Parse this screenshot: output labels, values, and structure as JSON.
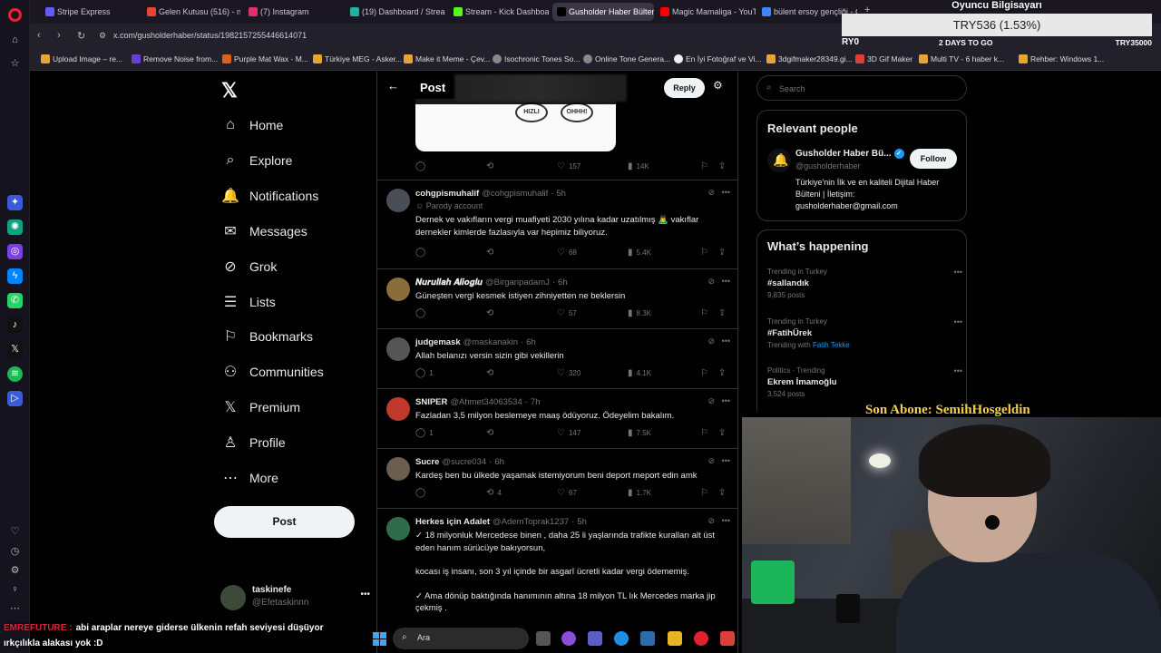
{
  "browser": {
    "tabs": [
      {
        "label": "Stripe Express",
        "color": "#635bff"
      },
      {
        "label": "Gelen Kutusu (516) - nose",
        "color": "#ea4335"
      },
      {
        "label": "(7) Instagram",
        "color": "#e1306c"
      },
      {
        "label": "(19) Dashboard / Streamla",
        "color": "#1bb5a0"
      },
      {
        "label": "Stream - Kick Dashboard",
        "color": "#53fc18"
      },
      {
        "label": "Gusholder Haber Bülteni",
        "color": "#000000"
      },
      {
        "label": "Magic Mamaliga - YouTub",
        "color": "#ff0000"
      },
      {
        "label": "bülent ersoy gençliği - Go",
        "color": "#4285f4"
      }
    ],
    "url": "x.com/gusholderhaber/status/1982157255446614071",
    "bookmarks": [
      "Upload Image – re...",
      "Remove Noise from...",
      "Purple Mat Wax - M...",
      "Türkiye MEG - Asker...",
      "Make it Meme - Çev...",
      "Isochronic Tones So...",
      "Online Tone Genera...",
      "En İyi Fotoğraf ve Vi...",
      "3dgifmaker28349.gi...",
      "3D Gif Maker",
      "Multi TV - 6 haber k...",
      "Rehber: Windows 1..."
    ]
  },
  "nav": {
    "items": [
      {
        "label": "Home",
        "icon": "home-icon"
      },
      {
        "label": "Explore",
        "icon": "search-icon"
      },
      {
        "label": "Notifications",
        "icon": "bell-icon"
      },
      {
        "label": "Messages",
        "icon": "mail-icon"
      },
      {
        "label": "Grok",
        "icon": "grok-icon"
      },
      {
        "label": "Lists",
        "icon": "list-icon"
      },
      {
        "label": "Bookmarks",
        "icon": "bookmark-icon"
      },
      {
        "label": "Communities",
        "icon": "communities-icon"
      },
      {
        "label": "Premium",
        "icon": "x-icon"
      },
      {
        "label": "Profile",
        "icon": "profile-icon"
      },
      {
        "label": "More",
        "icon": "more-icon"
      }
    ],
    "post_label": "Post",
    "account": {
      "name": "taskinefe",
      "handle": "@Efetaskinnn"
    }
  },
  "center": {
    "title": "Post",
    "reply_label": "Reply",
    "media_stamps": [
      "HIZLI",
      "OHHH!"
    ],
    "top_stats": {
      "replies": "",
      "reposts": "",
      "likes": "157",
      "views": "14K"
    },
    "tweets": [
      {
        "name": "cohgpismuhalif",
        "handle": "@cohgpismuhalif",
        "time": "5h",
        "parody": "Parody account",
        "text": "Dernek ve vakıfların vergi muafiyeti 2030 yılına kadar uzatılmış 🙇‍♂️ vakıflar dernekler kimlerde fazlasıyla var hepimiz biliyoruz.",
        "replies": "",
        "reposts": "",
        "likes": "68",
        "views": "5.4K",
        "avatar": "#4a4f57"
      },
      {
        "name": "𝑵𝒖𝒓𝒖𝒍𝒍𝒂𝒉 𝑨𝒍𝒊𝒐𝒈𝒍𝒖",
        "handle": "@BirgaripadamJ",
        "time": "6h",
        "text": "Güneşten vergi kesmek istiyen zihniyetten ne beklersin",
        "replies": "",
        "reposts": "",
        "likes": "57",
        "views": "8.3K",
        "avatar": "#8a6d3b"
      },
      {
        "name": "judgemask",
        "handle": "@maskanakin",
        "time": "6h",
        "text": "Allah belanızı versin sizin gibi vekillerin",
        "replies": "1",
        "reposts": "",
        "likes": "320",
        "views": "4.1K",
        "avatar": "#555555"
      },
      {
        "name": "SNIPER",
        "handle": "@Ahmet34063534",
        "time": "7h",
        "text": "Fazladan 3,5 milyon beslemeye maaş ödüyoruz. Ödeyelim bakalım.",
        "replies": "1",
        "reposts": "",
        "likes": "147",
        "views": "7.5K",
        "avatar": "#c0392b"
      },
      {
        "name": "Sucre",
        "handle": "@sucre034",
        "time": "6h",
        "text": "Kardeş ben bu ülkede yaşamak istemiyorum beni deport meport edin amk",
        "replies": "",
        "reposts": "4",
        "likes": "67",
        "views": "1.7K",
        "avatar": "#6b5d4f"
      },
      {
        "name": "Herkes için Adalet",
        "handle": "@AdemToprak1237",
        "time": "5h",
        "text_lines": [
          "✓ 18 milyonluk Mercedese binen , daha 25 li yaşlarında trafikte kuralları alt üst eden hanım sürücüye bakıyorsun,",
          "kocası iş insanı, son 3 yıl içinde bir asgarî ücretli kadar vergi ödememiş.",
          "✓ Ama dönüp baktığında hanımının altına 18 milyon TL lık Mercedes marka jip çekmiş ."
        ],
        "avatar": "#2f6b4a"
      }
    ]
  },
  "right": {
    "search_placeholder": "Search",
    "relevant_title": "Relevant people",
    "person": {
      "name": "Gusholder Haber Bü...",
      "handle": "@gusholderhaber",
      "follow_label": "Follow",
      "bio": "Türkiye'nin İlk ve en kaliteli Dijital Haber Bülteni | İletişim: gusholderhaber@gmail.com"
    },
    "happening_title": "What’s happening",
    "trends": [
      {
        "context": "Trending in Turkey",
        "title": "#sallandık",
        "meta": "9,835 posts",
        "with": ""
      },
      {
        "context": "Trending in Turkey",
        "title": "#FatihÜrek",
        "meta": "Trending with",
        "with": "Fatih Tekke"
      },
      {
        "context": "Politics · Trending",
        "title": "Ekrem İmamoğlu",
        "meta": "3,524 posts",
        "with": ""
      }
    ]
  },
  "overlay": {
    "title": "Oyuncu Bilgisayarı",
    "price": "TRY536 (1.53%)",
    "left": "RY0",
    "mid": "2 DAYS TO GO",
    "right": "TRY35000",
    "last_sub": "Son Abone: SemihHosgeldin"
  },
  "chat": {
    "user": "EMREFUTURE :",
    "line1": "abi araplar nereye giderse ülkenin refah seviyesi düşüyor",
    "line2": "ırkçılıkla alakası yok :D"
  },
  "taskbar": {
    "search_label": "Ara"
  }
}
